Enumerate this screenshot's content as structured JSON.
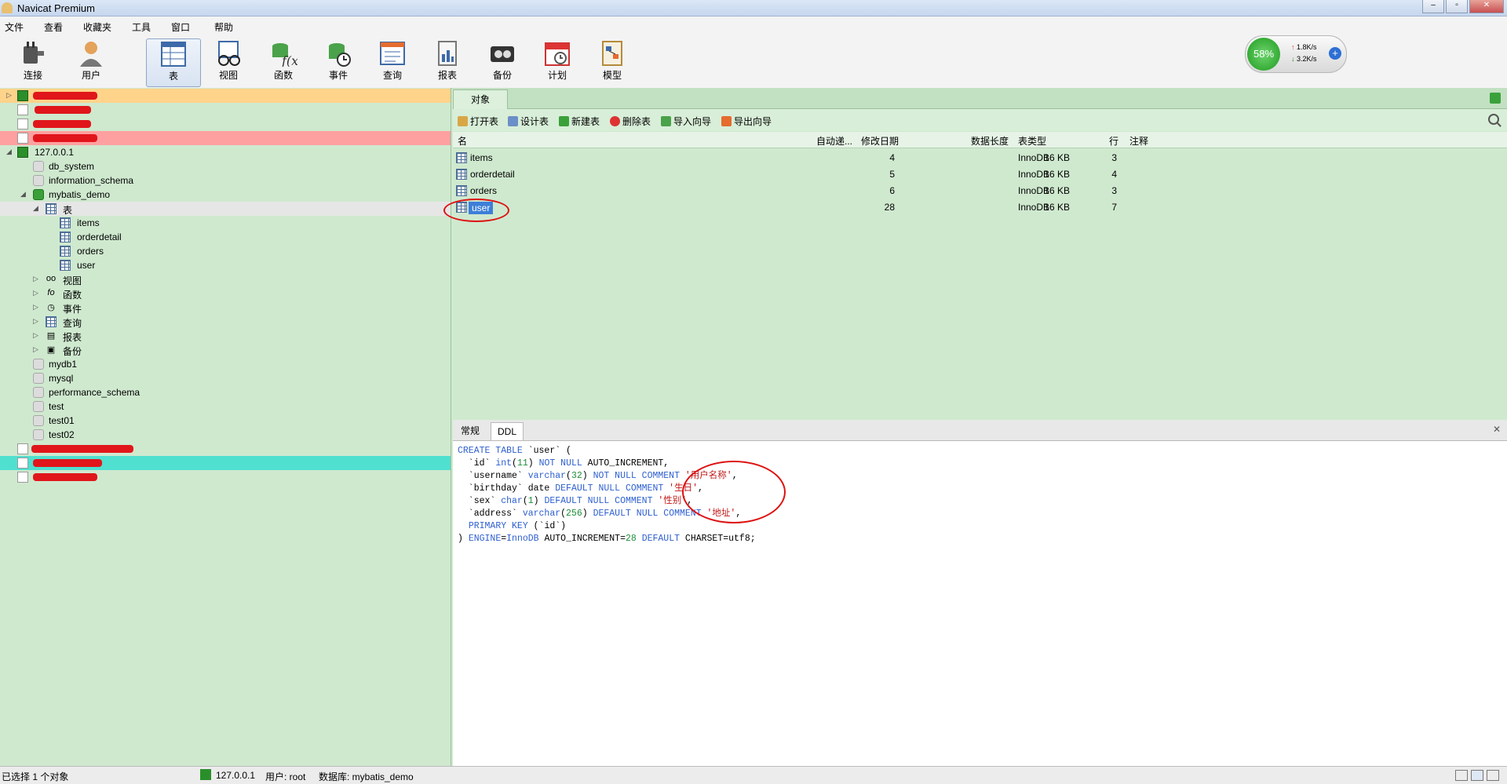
{
  "window": {
    "title": "Navicat Premium",
    "controls": [
      "minimize",
      "maximize",
      "close"
    ]
  },
  "menu": [
    "文件",
    "查看",
    "收藏夹",
    "工具",
    "窗口",
    "帮助"
  ],
  "toolbar": {
    "items": [
      {
        "label": "连接",
        "icon": "plug-icon"
      },
      {
        "label": "用户",
        "icon": "user-icon"
      },
      {
        "label": "表",
        "icon": "table-icon",
        "active": true
      },
      {
        "label": "视图",
        "icon": "view-glasses-icon"
      },
      {
        "label": "函数",
        "icon": "function-icon"
      },
      {
        "label": "事件",
        "icon": "event-clock-icon"
      },
      {
        "label": "查询",
        "icon": "query-icon"
      },
      {
        "label": "报表",
        "icon": "report-icon"
      },
      {
        "label": "备份",
        "icon": "backup-icon"
      },
      {
        "label": "计划",
        "icon": "calendar-icon"
      },
      {
        "label": "模型",
        "icon": "model-icon"
      }
    ]
  },
  "network": {
    "percent": "58%",
    "up": "1.8K/s",
    "down": "3.2K/s",
    "accent": "#1c9a1c"
  },
  "sidebar": {
    "connections_top": [
      {
        "label": "10.xxx (redacted)",
        "bg": "#ffd38a",
        "redacted": true
      },
      {
        "label": "redacted",
        "redacted": true
      },
      {
        "label": "redacted",
        "redacted": true
      },
      {
        "label": "redacted",
        "bg": "#ffa0a0",
        "redacted": true
      }
    ],
    "local_connection": "127.0.0.1",
    "databases": [
      "db_system",
      "information_schema",
      "mybatis_demo"
    ],
    "tables_node": "表",
    "tables": [
      "items",
      "orderdetail",
      "orders",
      "user"
    ],
    "groups": [
      {
        "label": "视图",
        "icon": "view-glasses-icon"
      },
      {
        "label": "函数",
        "icon": "function-icon"
      },
      {
        "label": "事件",
        "icon": "event-clock-icon"
      },
      {
        "label": "查询",
        "icon": "query-icon"
      },
      {
        "label": "报表",
        "icon": "report-icon"
      },
      {
        "label": "备份",
        "icon": "backup-icon"
      }
    ],
    "other_databases": [
      "mydb1",
      "mysql",
      "performance_schema",
      "test",
      "test01",
      "test02"
    ],
    "connections_bottom": [
      {
        "label": "redacted",
        "redacted": true
      },
      {
        "label": "redacted",
        "bg": "#4fe0d0",
        "redacted": true
      },
      {
        "label": "redacted",
        "redacted": true
      }
    ]
  },
  "main": {
    "tab": "对象",
    "object_toolbar": [
      "打开表",
      "设计表",
      "新建表",
      "删除表",
      "导入向导",
      "导出向导"
    ],
    "columns": [
      "名",
      "自动递...",
      "修改日期",
      "数据长度",
      "表类型",
      "行",
      "注释"
    ],
    "rows": [
      {
        "name": "items",
        "auto_inc": "4",
        "size": "16 KB",
        "engine": "InnoDB",
        "rows": "3"
      },
      {
        "name": "orderdetail",
        "auto_inc": "5",
        "size": "16 KB",
        "engine": "InnoDB",
        "rows": "4"
      },
      {
        "name": "orders",
        "auto_inc": "6",
        "size": "16 KB",
        "engine": "InnoDB",
        "rows": "3"
      },
      {
        "name": "user",
        "auto_inc": "28",
        "size": "16 KB",
        "engine": "InnoDB",
        "rows": "7",
        "selected": true
      }
    ],
    "lower_tabs": [
      "常规",
      "DDL"
    ],
    "lower_active": "DDL",
    "ddl_lines": [
      "CREATE TABLE `user` (",
      "  `id` int(11) NOT NULL AUTO_INCREMENT,",
      "  `username` varchar(32) NOT NULL COMMENT '用户名称',",
      "  `birthday` date DEFAULT NULL COMMENT '生日',",
      "  `sex` char(1) DEFAULT NULL COMMENT '性别',",
      "  `address` varchar(256) DEFAULT NULL COMMENT '地址',",
      "  PRIMARY KEY (`id`)",
      ") ENGINE=InnoDB AUTO_INCREMENT=28 DEFAULT CHARSET=utf8;"
    ]
  },
  "status": {
    "selection": "已选择 1 个对象",
    "connection": "127.0.0.1",
    "user": "用户: root",
    "database": "数据库: mybatis_demo"
  }
}
